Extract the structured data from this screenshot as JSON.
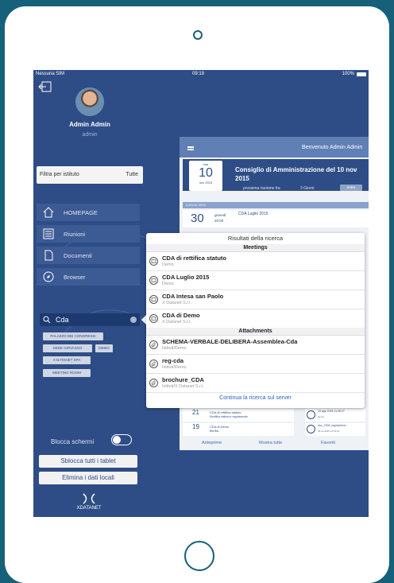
{
  "status_bar": {
    "carrier": "Nessuna SIM",
    "time": "09:19",
    "battery": "100%"
  },
  "user": {
    "name": "Admin Admin",
    "login": "admin"
  },
  "filter": {
    "label": "Filtra per istituto",
    "value": "Tutte"
  },
  "nav": [
    {
      "label": "HOMEPAGE",
      "icon": "home-icon"
    },
    {
      "label": "Riunioni",
      "icon": "list-icon"
    },
    {
      "label": "Documenti",
      "icon": "document-icon"
    },
    {
      "label": "Browser",
      "icon": "compass-icon"
    }
  ],
  "search": {
    "value": "Cda"
  },
  "chips": [
    "PALAZZO DEI CONGRESSI",
    "SEDE GIRVASSO",
    "DEMO",
    "X DATANET SPA",
    "MEETING ROOM"
  ],
  "blocca": {
    "label": "Blocca schermi"
  },
  "buttons": {
    "unlock_all": "Sblocca tutti i tablet",
    "delete_local": "Elimina i dati locali"
  },
  "logo": {
    "text": "XDATANET"
  },
  "background": {
    "welcome": "Benvenuto Admin Admin",
    "date_month": "mar",
    "date_day": "10",
    "date_monthyear": "nov 2015",
    "meeting_title": "Consiglio di Amministrazione del 10 nov 2015",
    "next_meeting": "prossima riunione fra",
    "days": "3 Giorni",
    "enter": "entra",
    "month_band": "LUGLIO 2015",
    "row30": {
      "day": "30",
      "weekday": "giovedì",
      "time": "20:00",
      "title": "CDA Luglio 2015"
    },
    "list_rows": [
      {
        "day": "21",
        "weekday": "mer",
        "date": "ott 2015",
        "time": "15:00",
        "title": "CDA di rettifica statuto",
        "sub": "Modifica statuto e regolamento"
      },
      {
        "day": "19",
        "weekday": "lun",
        "date": "ott 2015",
        "time": "10:00",
        "title": "CDA di Demo",
        "sub": "Bla Bla"
      }
    ],
    "right_cards": [
      {
        "title": "",
        "sub": "19 ago 2015 11:28:27",
        "extra": "Demo"
      },
      {
        "title": "doc_YDM_regolament...",
        "sub": "04 ott 2015 11:19:13",
        "extra": "X Datanet Spa"
      }
    ],
    "bottom": {
      "preview": "Anteprime",
      "show_all": "Mostra tutte",
      "favorites": "Favoriti"
    }
  },
  "popup": {
    "title": "Risultati della ricerca",
    "meetings_header": "Meetings",
    "meetings": [
      {
        "title": "CDA di rettifica statuto",
        "sub": "Demo"
      },
      {
        "title": "CDA Luglio 2015",
        "sub": "Demo"
      },
      {
        "title": "CDA Intesa san Paolo",
        "sub": "X Datanet S.r.l."
      },
      {
        "title": "CDA di Demo",
        "sub": "X Datanet S.r.l."
      }
    ],
    "attachments_header": "Attachments",
    "attachments": [
      {
        "title": "SCHEMA-VERBALE-DELIBERA-Assemblea-Cda",
        "sub": "Istituti/Demo"
      },
      {
        "title": "reg-cda",
        "sub": "Istituti/Demo"
      },
      {
        "title": "brochure_CDA",
        "sub": "Istituti/X Datanet S.r.l."
      }
    ],
    "footer": "Continua la ricerca sul server"
  }
}
